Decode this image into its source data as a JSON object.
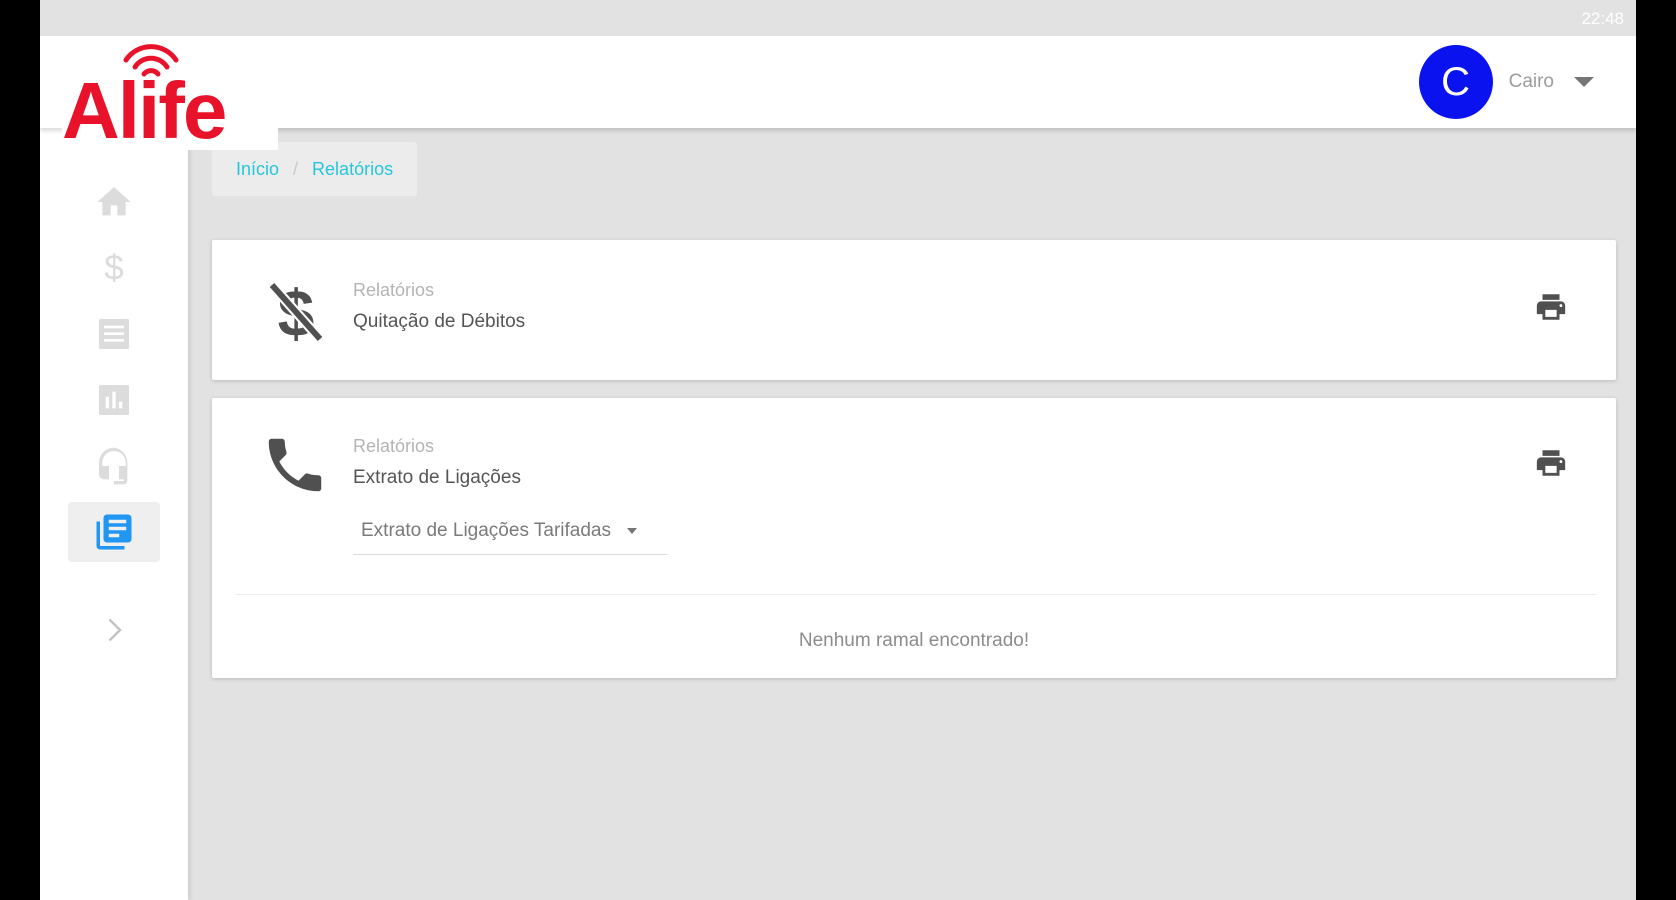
{
  "status_bar": {
    "time": "22:48"
  },
  "logo": {
    "text": "Alife",
    "color": "#e8132a"
  },
  "user": {
    "initial": "C",
    "name": "Cairo",
    "avatar_color": "#0b12f0"
  },
  "sidebar": {
    "items": [
      {
        "icon": "home-icon",
        "active": false
      },
      {
        "icon": "dollar-icon",
        "active": false
      },
      {
        "icon": "list-icon",
        "active": false
      },
      {
        "icon": "bar-chart-icon",
        "active": false
      },
      {
        "icon": "headset-icon",
        "active": false
      },
      {
        "icon": "reports-icon",
        "active": true
      },
      {
        "icon": "chevron-right-icon",
        "active": false
      }
    ]
  },
  "breadcrumb": {
    "home": "Início",
    "separator": "/",
    "current": "Relatórios"
  },
  "cards": [
    {
      "label": "Relatórios",
      "title": "Quitação de Débitos",
      "icon": "money-off-icon",
      "action_icon": "print-icon"
    },
    {
      "label": "Relatórios",
      "title": "Extrato de Ligações",
      "icon": "phone-icon",
      "action_icon": "print-icon",
      "select": {
        "value": "Extrato de Ligações Tarifadas"
      },
      "empty_message": "Nenhum ramal encontrado!"
    }
  ],
  "colors": {
    "accent": "#26c6da",
    "active_icon": "#2196f3",
    "icon": "#dcdcdc"
  }
}
